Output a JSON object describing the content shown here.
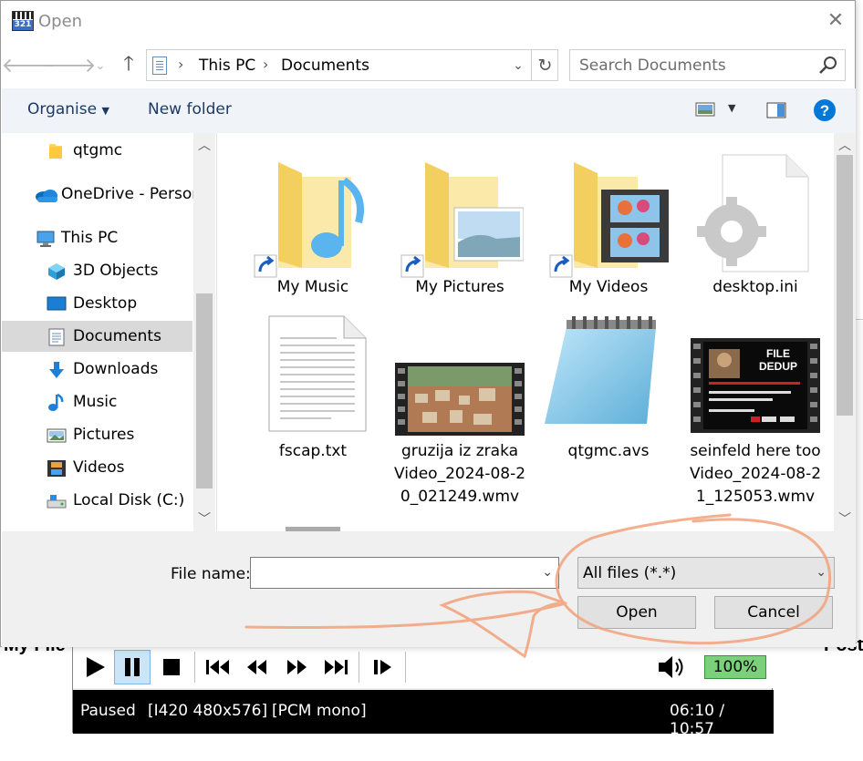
{
  "dialog": {
    "title": "Open",
    "address": {
      "crumbs": [
        "This PC",
        "Documents"
      ]
    },
    "search_placeholder": "Search Documents",
    "toolbar": {
      "organise": "Organise",
      "new_folder": "New folder"
    },
    "nav_items": [
      {
        "label": "qtgmc",
        "icon": "folder-icon"
      },
      {
        "label": "OneDrive - Person",
        "icon": "onedrive-icon"
      },
      {
        "label": "This PC",
        "icon": "computer-icon"
      },
      {
        "label": "3D Objects",
        "icon": "3d-objects-icon"
      },
      {
        "label": "Desktop",
        "icon": "desktop-icon"
      },
      {
        "label": "Documents",
        "icon": "documents-icon",
        "selected": true
      },
      {
        "label": "Downloads",
        "icon": "downloads-icon"
      },
      {
        "label": "Music",
        "icon": "music-icon"
      },
      {
        "label": "Pictures",
        "icon": "pictures-icon"
      },
      {
        "label": "Videos",
        "icon": "videos-icon"
      },
      {
        "label": "Local Disk (C:)",
        "icon": "drive-icon"
      }
    ],
    "files": [
      {
        "name": "My Music",
        "icon": "music-folder-shortcut-icon"
      },
      {
        "name": "My Pictures",
        "icon": "pictures-folder-shortcut-icon"
      },
      {
        "name": "My Videos",
        "icon": "videos-folder-shortcut-icon"
      },
      {
        "name": "desktop.ini",
        "icon": "settings-file-icon"
      },
      {
        "name": "fscap.txt",
        "icon": "text-file-icon"
      },
      {
        "name_lines": [
          "gruzija iz zraka",
          "Video_2024-08-2",
          "0_021249.wmv"
        ],
        "icon": "video-thumbnail-icon"
      },
      {
        "name": "qtgmc.avs",
        "icon": "notepad-file-icon"
      },
      {
        "name_lines": [
          "seinfeld here too",
          "Video_2024-08-2",
          "1_125053.wmv"
        ],
        "icon": "video-thumbnail-icon",
        "thumb_text": "FILE DEDUP"
      }
    ],
    "file_name_label": "File name:",
    "file_name_value": "",
    "file_type": "All files (*.*)",
    "open_label": "Open",
    "cancel_label": "Cancel"
  },
  "player": {
    "volume": "100%",
    "status": "Paused",
    "format": "[I420 480x576]",
    "audio": "[PCM mono]",
    "time": "06:10 / 10:57"
  },
  "background": {
    "left_fragment": "My File",
    "right_fragment": "Post"
  },
  "colors": {
    "toolbar_bg": "#f0f4f9",
    "accent": "#0078d7",
    "annotation": "#f2a27a",
    "volume_bg": "#7ad17a"
  }
}
